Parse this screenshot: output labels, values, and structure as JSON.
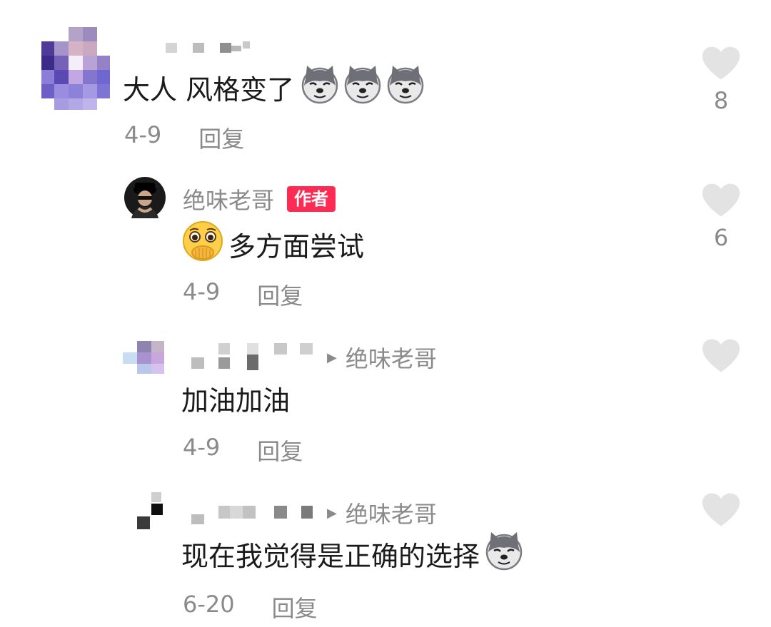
{
  "comments": [
    {
      "text": "大人 风格变了",
      "emojis": [
        "doge",
        "doge",
        "doge"
      ],
      "date": "4-9",
      "reply_label": "回复",
      "likes": "8"
    },
    {
      "author": "绝味老哥",
      "badge": "作者",
      "lead_emoji": "shy-face",
      "text": "多方面尝试",
      "date": "4-9",
      "reply_label": "回复",
      "likes": "6"
    },
    {
      "reply_to": "绝味老哥",
      "text": "加油加油",
      "date": "4-9",
      "reply_label": "回复"
    },
    {
      "reply_to": "绝味老哥",
      "text": "现在我觉得是正确的选择",
      "emojis": [
        "doge"
      ],
      "date": "6-20",
      "reply_label": "回复"
    }
  ],
  "icons": {
    "like": "heart-icon",
    "reply_to": "triangle-right-icon"
  },
  "colors": {
    "secondary_text": "#8a8a8a",
    "badge": "#fe2c55",
    "heart": "#e3e3e3"
  }
}
